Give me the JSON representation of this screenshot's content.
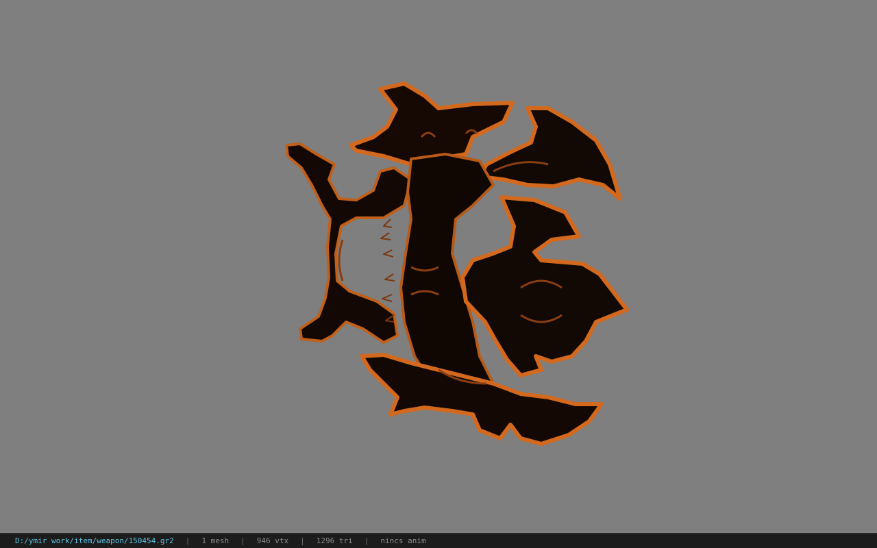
{
  "viewport": {
    "background_color": "#7f7f7f",
    "model": {
      "icon": "weapon-model-icon",
      "base_color": "#120804",
      "rim_color": "#d2691e",
      "highlight_color": "#e8801f"
    }
  },
  "status_bar": {
    "file_path": "D:/ymir work/item/weapon/150454.gr2",
    "separator": "|",
    "mesh_count": "1 mesh",
    "vertex_count": "946 vtx",
    "triangle_count": "1296 tri",
    "animation": "nincs anim",
    "path_color": "#5ec3e6"
  }
}
